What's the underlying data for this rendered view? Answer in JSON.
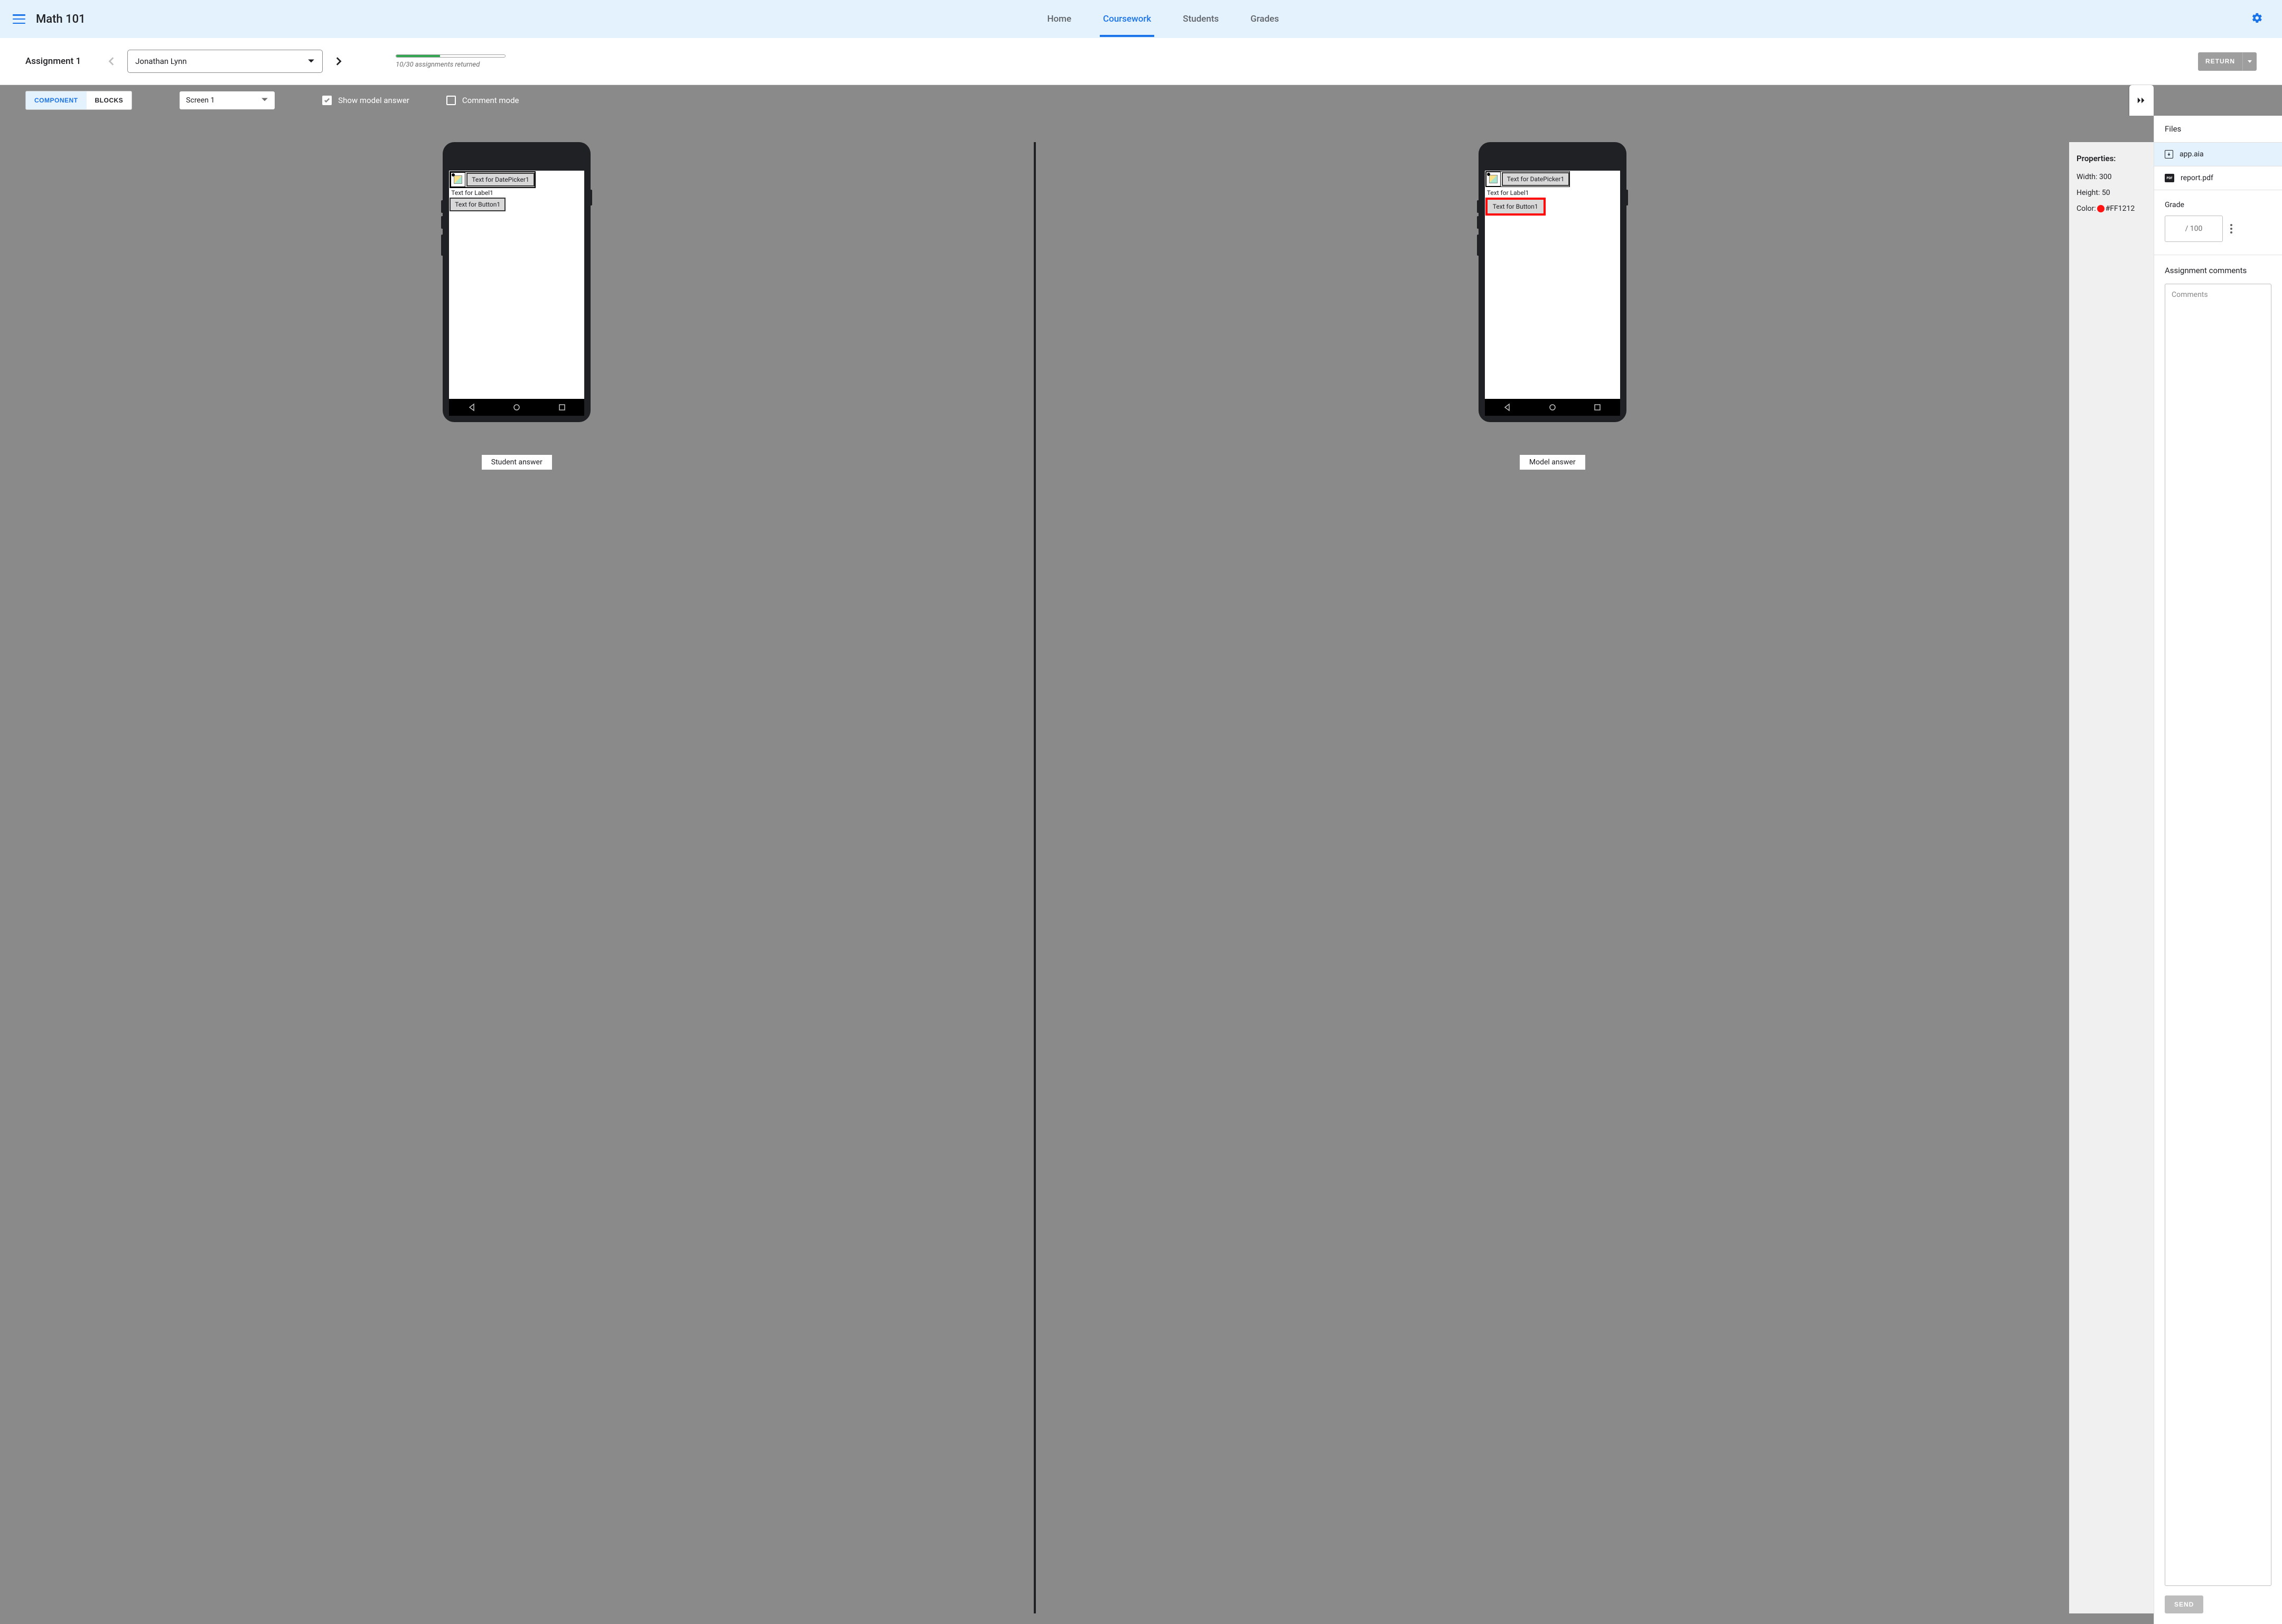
{
  "header": {
    "course_title": "Math 101",
    "tabs": [
      "Home",
      "Coursework",
      "Students",
      "Grades"
    ],
    "active_tab": "Coursework"
  },
  "assignment_bar": {
    "title": "Assignment 1",
    "student_name": "Jonathan Lynn",
    "progress_text": "10/30 assignments returned",
    "progress_pct": 40,
    "return_label": "RETURN"
  },
  "toolbar": {
    "component_label": "COMPONENT",
    "blocks_label": "BLOCKS",
    "screen_value": "Screen 1",
    "show_model_label": "Show model answer",
    "show_model_checked": true,
    "comment_mode_label": "Comment mode",
    "comment_mode_checked": false
  },
  "previews": {
    "student_caption": "Student answer",
    "model_caption": "Model answer",
    "datepicker_text": "Text for DatePicker1",
    "label_text": "Text for Label1",
    "button_text": "Text for Button1"
  },
  "properties": {
    "title": "Properties:",
    "width_label": "Width:",
    "width_value": "300",
    "height_label": "Height:",
    "height_value": "50",
    "color_label": "Color:",
    "color_value": "#FF1212"
  },
  "sidebar": {
    "files_title": "Files",
    "files": [
      {
        "name": "app.aia",
        "type": "aia",
        "active": true
      },
      {
        "name": "report.pdf",
        "type": "pdf",
        "active": false
      }
    ],
    "grade_title": "Grade",
    "grade_suffix": "/ 100",
    "comments_title": "Assignment comments",
    "comments_placeholder": "Comments",
    "send_label": "SEND"
  }
}
